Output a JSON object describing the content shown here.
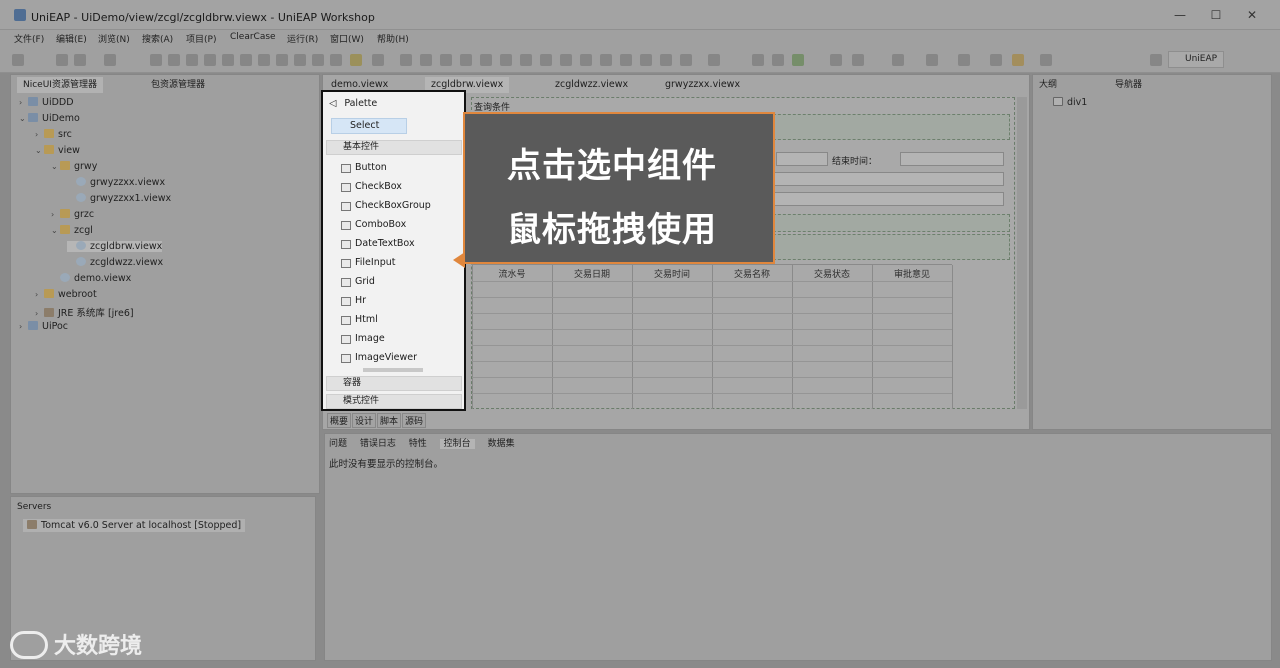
{
  "window": {
    "title": "UniEAP  -  UiDemo/view/zcgl/zcgldbrw.viewx  -  UniEAP Workshop",
    "controls": [
      "—",
      "☐",
      "✕"
    ]
  },
  "menu": [
    "文件(F)",
    "编辑(E)",
    "浏览(N)",
    "搜索(A)",
    "项目(P)",
    "ClearCase",
    "运行(R)",
    "窗口(W)",
    "帮助(H)"
  ],
  "toolbar": {
    "perspective_label": "UniEAP"
  },
  "left_panel": {
    "tabs": [
      "NiceUI资源管理器",
      "包资源管理器"
    ],
    "tree": [
      {
        "label": "UiDDD",
        "level": 0,
        "icon": "proj",
        "arrow": "›"
      },
      {
        "label": "UiDemo",
        "level": 0,
        "icon": "proj",
        "arrow": "⌄"
      },
      {
        "label": "src",
        "level": 1,
        "icon": "folder",
        "arrow": "›"
      },
      {
        "label": "view",
        "level": 1,
        "icon": "folder",
        "arrow": "⌄"
      },
      {
        "label": "grwy",
        "level": 2,
        "icon": "folder",
        "arrow": "⌄"
      },
      {
        "label": "grwyzzxx.viewx",
        "level": 3,
        "icon": "file",
        "arrow": ""
      },
      {
        "label": "grwyzzxx1.viewx",
        "level": 3,
        "icon": "file",
        "arrow": ""
      },
      {
        "label": "grzc",
        "level": 2,
        "icon": "folder",
        "arrow": "›"
      },
      {
        "label": "zcgl",
        "level": 2,
        "icon": "folder",
        "arrow": "⌄"
      },
      {
        "label": "zcgldbrw.viewx",
        "level": 3,
        "icon": "file",
        "arrow": ""
      },
      {
        "label": "zcgldwzz.viewx",
        "level": 3,
        "icon": "file",
        "arrow": ""
      },
      {
        "label": "demo.viewx",
        "level": 2,
        "icon": "file",
        "arrow": ""
      },
      {
        "label": "webroot",
        "level": 1,
        "icon": "folder",
        "arrow": "›"
      },
      {
        "label": "JRE 系统库 [jre6]",
        "level": 1,
        "icon": "lib",
        "arrow": "›"
      },
      {
        "label": "UiPoc",
        "level": 0,
        "icon": "proj",
        "arrow": "›"
      }
    ]
  },
  "servers": {
    "tab": "Servers",
    "entry": "Tomcat v6.0 Server at localhost  [Stopped]"
  },
  "editor": {
    "tabs": [
      "demo.viewx",
      "zcgldbrw.viewx",
      "zcgldwzz.viewx",
      "grwyzzxx.viewx"
    ],
    "section_title": "查询条件",
    "end_time_label": "结束时间：",
    "grid_headers": [
      "流水号",
      "交易日期",
      "交易时间",
      "交易名称",
      "交易状态",
      "审批意见"
    ],
    "view_tabs": [
      "概要",
      "设计",
      "脚本",
      "源码"
    ]
  },
  "palette": {
    "title": "Palette",
    "select_label": "Select",
    "section_basic": "基本控件",
    "items": [
      "Button",
      "CheckBox",
      "CheckBoxGroup",
      "ComboBox",
      "DateTextBox",
      "FileInput",
      "Grid",
      "Hr",
      "Html",
      "Image",
      "ImageViewer"
    ],
    "section_container": "容器",
    "section_mode": "模式控件"
  },
  "callout": {
    "line1": "点击选中组件",
    "line2": "鼠标拖拽使用"
  },
  "outline": {
    "tabs": [
      "大纲",
      "导航器"
    ],
    "item": "div1"
  },
  "console": {
    "tabs": [
      "问题",
      "错误日志",
      "特性",
      "控制台",
      "数据集"
    ],
    "message": "此时没有要显示的控制台。"
  },
  "watermark": "大数跨境"
}
